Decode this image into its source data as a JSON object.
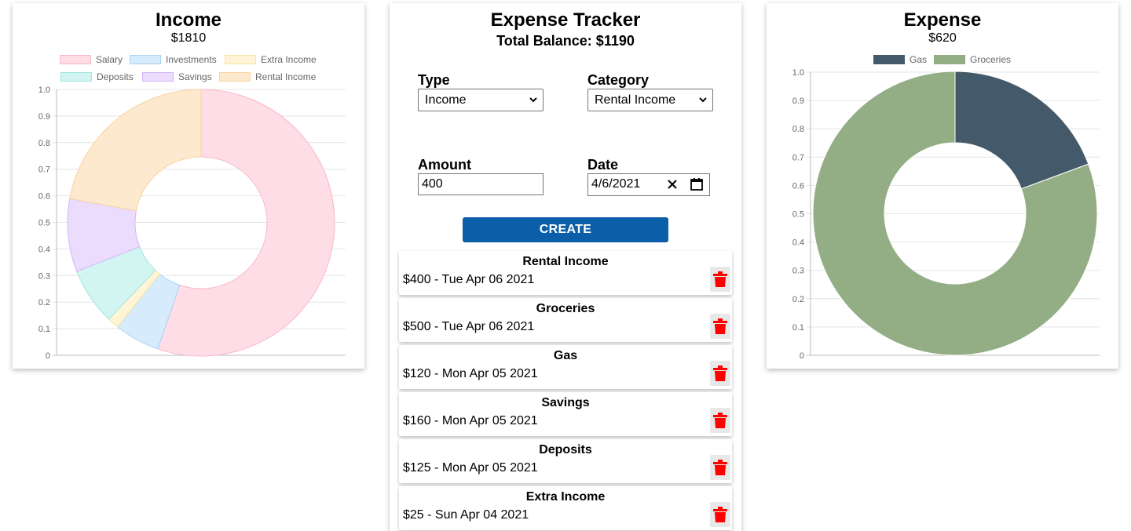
{
  "income": {
    "title": "Income",
    "total": "$1810",
    "legend": [
      {
        "label": "Salary",
        "color": "#ffdde6",
        "border": "#f7b8c8"
      },
      {
        "label": "Investments",
        "color": "#d6ebfb",
        "border": "#a9d3f3"
      },
      {
        "label": "Extra Income",
        "color": "#fff4d6",
        "border": "#fbe3a2"
      },
      {
        "label": "Deposits",
        "color": "#d3f5f2",
        "border": "#9fe6df"
      },
      {
        "label": "Savings",
        "color": "#ebdcfd",
        "border": "#d2b6f7"
      },
      {
        "label": "Rental Income",
        "color": "#fde9cd",
        "border": "#f7d3a1"
      }
    ]
  },
  "tracker": {
    "title": "Expense Tracker",
    "balance": "Total Balance: $1190",
    "type_label": "Type",
    "type_value": "Income",
    "category_label": "Category",
    "category_value": "Rental Income",
    "amount_label": "Amount",
    "amount_value": "400",
    "date_label": "Date",
    "date_value": "4/6/2021",
    "create_label": "CREATE",
    "transactions": [
      {
        "category": "Rental Income",
        "line": "$400 - Tue Apr 06 2021"
      },
      {
        "category": "Groceries",
        "line": "$500 - Tue Apr 06 2021"
      },
      {
        "category": "Gas",
        "line": "$120 - Mon Apr 05 2021"
      },
      {
        "category": "Savings",
        "line": "$160 - Mon Apr 05 2021"
      },
      {
        "category": "Deposits",
        "line": "$125 - Mon Apr 05 2021"
      },
      {
        "category": "Extra Income",
        "line": "$25 - Sun Apr 04 2021"
      }
    ],
    "delete_color": "#ff0000",
    "accent": "#0b5fa8"
  },
  "expense": {
    "title": "Expense",
    "total": "$620",
    "legend": [
      {
        "label": "Gas",
        "color": "#445a6a",
        "border": "#445a6a"
      },
      {
        "label": "Groceries",
        "color": "#93ad84",
        "border": "#93ad84"
      }
    ]
  },
  "chart_data": [
    {
      "type": "doughnut",
      "title": "Income",
      "categories": [
        "Salary",
        "Investments",
        "Extra Income",
        "Deposits",
        "Savings",
        "Rental Income"
      ],
      "values": [
        1000,
        100,
        25,
        125,
        160,
        400
      ],
      "y_ticks": [
        "1.0",
        "0.9",
        "0.8",
        "0.7",
        "0.6",
        "0.5",
        "0.4",
        "0.3",
        "0.2",
        "0.1",
        "0"
      ],
      "ylim": [
        0,
        1
      ],
      "grid": true,
      "legend_position": "top"
    },
    {
      "type": "doughnut",
      "title": "Expense",
      "categories": [
        "Gas",
        "Groceries"
      ],
      "values": [
        120,
        500
      ],
      "y_ticks": [
        "1.0",
        "0.9",
        "0.8",
        "0.7",
        "0.6",
        "0.5",
        "0.4",
        "0.3",
        "0.2",
        "0.1",
        "0"
      ],
      "ylim": [
        0,
        1
      ],
      "grid": true,
      "legend_position": "top"
    }
  ]
}
